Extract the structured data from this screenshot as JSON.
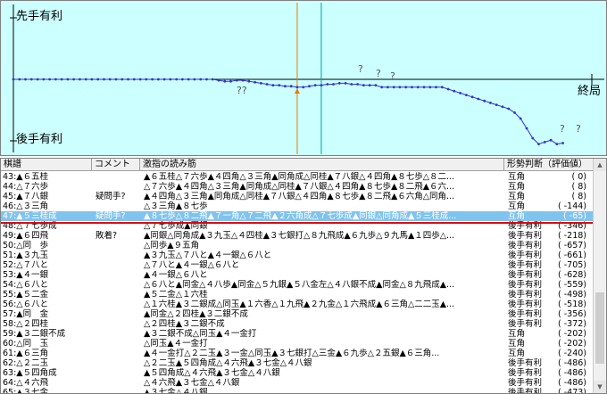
{
  "graph": {
    "label_top": "先手有利",
    "label_bottom": "後手有利",
    "label_end": "終局",
    "question_mark": "?",
    "double_question": "??",
    "colors": {
      "bg": "#ccffff",
      "line": "#3333cc",
      "marker": "#e08000",
      "axis": "#000000",
      "teal": "#00a0a0"
    },
    "curve": [
      0,
      0,
      0,
      0,
      0,
      0,
      0,
      0,
      0,
      0,
      0,
      0,
      0,
      0,
      0,
      0,
      0,
      0,
      0,
      0,
      0,
      0,
      0,
      0,
      0,
      0,
      0,
      0,
      0,
      0,
      0,
      0,
      0,
      0,
      -1,
      -2,
      -2,
      -1,
      -1,
      -2,
      -3,
      -4,
      -5,
      -6,
      -6,
      -7,
      -7,
      -8,
      -8,
      -7,
      -6,
      -6,
      -5,
      -5,
      -4,
      -4,
      -5,
      -5,
      -6,
      -6,
      -6,
      -8,
      -8,
      -8,
      -8,
      -8,
      -8,
      -8,
      -8,
      -8,
      -8,
      -8,
      -10,
      -12,
      -14,
      -16,
      -18,
      -20,
      -22,
      -24,
      -26,
      -28,
      -30,
      -34,
      -40,
      -50,
      -60,
      -66,
      -64,
      -62,
      -66,
      -65
    ],
    "current_move": 47
  },
  "table": {
    "headers": [
      "棋譜",
      "コメント",
      "激指の読み筋",
      "形勢判断（評価値）"
    ],
    "rows": [
      {
        "move": "43:▲６五桂",
        "comment": "",
        "read": "▲６五桂△７六歩▲４四角△３三角▲同角成△同桂▲７八銀△４四角▲８七歩△８二...",
        "judge": "互角",
        "value": "(      0)"
      },
      {
        "move": "44:△７六歩",
        "comment": "",
        "read": "△７六歩▲４四角△３三角▲同角成△同桂▲７八銀△４四角▲８七歩▲８二飛▲６六...",
        "judge": "互角",
        "value": "(      8)"
      },
      {
        "move": "45:▲７八銀",
        "comment": "疑問手?",
        "read": "▲４四角△３三角▲同角成△同桂▲７八銀△４四角▲８七歩▲８二飛▲６六角△同角...",
        "judge": "互角",
        "value": "(      8)"
      },
      {
        "move": "46:△３三角",
        "comment": "",
        "read": "△３三角▲８七歩",
        "judge": "互角",
        "value": "(   -144)"
      },
      {
        "move": "47:▲５三桂成",
        "comment": "疑問手?",
        "read": "▲８七歩△８二飛▲７一角△７二飛▲２六角成△７七歩成▲同銀△同角成▲５三桂成...",
        "judge": "互角",
        "value": "(    -65)"
      },
      {
        "move": "48:△７七歩成",
        "comment": "",
        "read": "△７七歩成▲同銀",
        "judge": "後手有利",
        "value": "(   -346)"
      },
      {
        "move": "49:▲６四飛",
        "comment": "敗着?",
        "read": "▲同銀△同角成▲３九玉△４四桂▲３七銀打△８九飛成▲６九歩△９九馬▲１四歩△...",
        "judge": "後手有利",
        "value": "(   -218)"
      },
      {
        "move": "50:△同　歩",
        "comment": "",
        "read": "△同歩▲９五角",
        "judge": "後手有利",
        "value": "(   -657)"
      },
      {
        "move": "51:▲３九玉",
        "comment": "",
        "read": "▲３九玉△７八と▲４一銀△６八と",
        "judge": "後手有利",
        "value": "(   -661)"
      },
      {
        "move": "52:△７八と",
        "comment": "",
        "read": "△７八と▲４一銀△６八と",
        "judge": "後手有利",
        "value": "(   -705)"
      },
      {
        "move": "53:▲４一銀",
        "comment": "",
        "read": "▲４一銀△６八と",
        "judge": "後手有利",
        "value": "(   -628)"
      },
      {
        "move": "54:△６八と",
        "comment": "",
        "read": "△６八と▲同金△４八歩▲同金△５九銀▲５八金左△４八銀不成▲同金△８九飛成▲...",
        "judge": "後手有利",
        "value": "(   -559)"
      },
      {
        "move": "55:▲５二金",
        "comment": "",
        "read": "▲５二金△１六桂",
        "judge": "後手有利",
        "value": "(   -498)"
      },
      {
        "move": "56:△６八と",
        "comment": "",
        "read": "△１六桂▲３二銀成△同玉▲１六香△１九飛▲２九金△１六飛成▲６三角△二二玉▲...",
        "judge": "後手有利",
        "value": "(   -518)"
      },
      {
        "move": "57:▲同　金",
        "comment": "",
        "read": "▲同金△２四桂▲３二銀不成",
        "judge": "後手有利",
        "value": "(   -356)"
      },
      {
        "move": "58:△２四桂",
        "comment": "",
        "read": "△２四桂▲３二銀不成",
        "judge": "後手有利",
        "value": "(   -372)"
      },
      {
        "move": "59:▲３二銀不成",
        "comment": "",
        "read": "▲３二銀不成△同玉▲４一金打",
        "judge": "互角",
        "value": "(   -202)"
      },
      {
        "move": "60:△同　玉",
        "comment": "",
        "read": "△同玉▲４一金打",
        "judge": "互角",
        "value": "(   -202)"
      },
      {
        "move": "61:▲６三角",
        "comment": "",
        "read": "▲４一金打△２二玉▲３一金△同玉▲３七銀打△三金▲６九歩△２五銀▲６三角...",
        "judge": "互角",
        "value": "(   -240)"
      },
      {
        "move": "62:△２二玉",
        "comment": "",
        "read": "△２二玉▲５四角成△４六飛▲３七金△４八銀",
        "judge": "後手有利",
        "value": "(   -486)"
      },
      {
        "move": "63:▲５四角成",
        "comment": "",
        "read": "▲５四角成△４六飛▲３七金△４八銀",
        "judge": "後手有利",
        "value": "(   -486)"
      },
      {
        "move": "64:△４六飛",
        "comment": "",
        "read": "△４六飛▲３七金△４八銀",
        "judge": "後手有利",
        "value": "(   -486)"
      },
      {
        "move": "65:▲３七金",
        "comment": "",
        "read": "▲３七金△４八銀",
        "judge": "後手有利",
        "value": "(   -473)"
      }
    ],
    "selected_index": 4
  }
}
